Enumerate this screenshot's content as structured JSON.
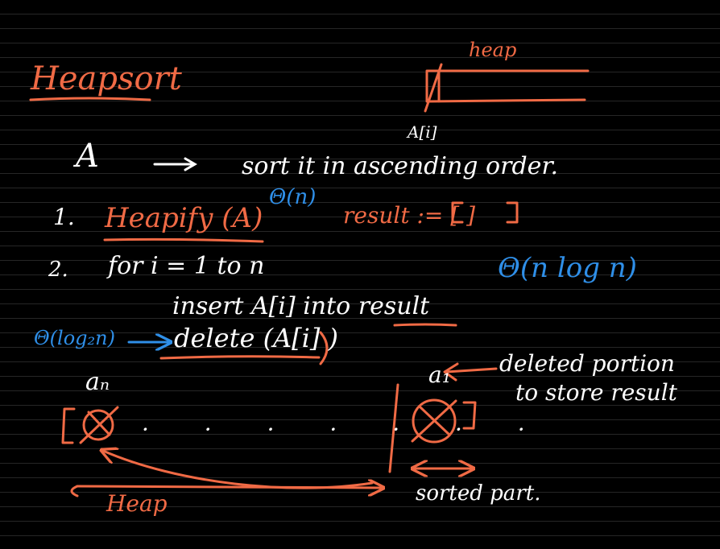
{
  "colors": {
    "background": "#000000",
    "orange_ink": "#f06a45",
    "blue_ink": "#2f8fe8",
    "white_ink": "#ffffff"
  },
  "title": "Heapsort",
  "heap_diagram": {
    "label": "heap",
    "index_label": "A[i]"
  },
  "line_a": {
    "array": "A",
    "arrow": "⟶",
    "text": "sort it in ascending order."
  },
  "step1": {
    "number": "1.",
    "call": "Heapify (A)",
    "cost": "Θ(n)",
    "text": "result := [ ]"
  },
  "step2": {
    "number": "2.",
    "text": "for i = 1 to n",
    "cost": "Θ(n log n)"
  },
  "insert_line": {
    "text": "insert A[i] into result"
  },
  "delete_line": {
    "cost": "Θ(log₂n)",
    "call": "delete (A[i] )"
  },
  "array_sketch": {
    "an_label": "aₙ",
    "a1_label": "a₁",
    "heap_label": "Heap",
    "sorted_label": "sorted part."
  },
  "note": {
    "line1": "deleted portion",
    "line2": "to store result"
  }
}
